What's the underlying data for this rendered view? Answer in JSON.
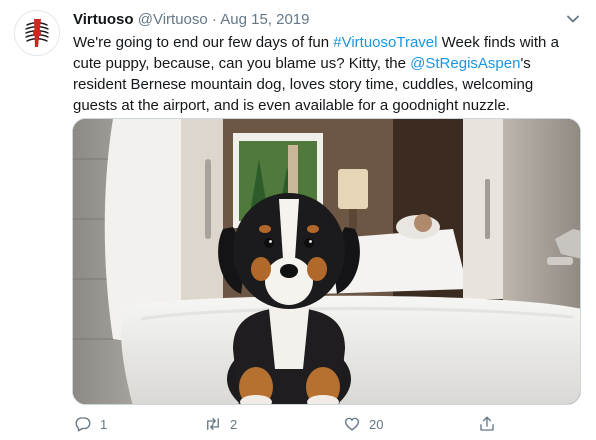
{
  "tweet": {
    "author_name": "Virtuoso",
    "handle": "@Virtuoso",
    "separator": "·",
    "date": "Aug 15, 2019",
    "text_parts": {
      "p1": "We're going to end our few days of fun ",
      "hashtag": "#VirtuosoTravel",
      "p2": " Week finds with a cute puppy, because, can you blame us? Kitty, the ",
      "mention": "@StRegisAspen",
      "p3": "'s resident Bernese mountain dog, loves story time, cuddles, welcoming guests at the airport, and is even available for a goodnight nuzzle."
    }
  },
  "actions": {
    "reply_count": "1",
    "retweet_count": "2",
    "like_count": "20"
  },
  "icons": [
    "chevron-down-icon",
    "reply-icon",
    "retweet-icon",
    "like-icon",
    "share-icon"
  ],
  "colors": {
    "link": "#1b95e0",
    "muted": "#657786",
    "text": "#14171a",
    "border": "#ccd6dd"
  }
}
